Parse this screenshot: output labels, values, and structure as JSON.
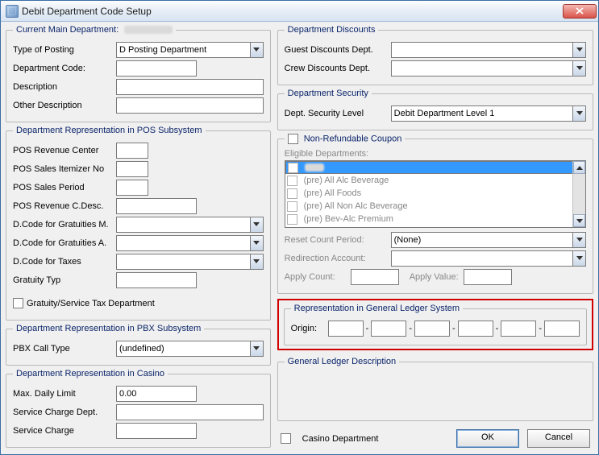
{
  "window": {
    "title": "Debit Department Code Setup"
  },
  "left": {
    "main_dept": {
      "legend": "Current Main Department:",
      "type_of_posting_label": "Type of Posting",
      "type_of_posting_value": "D Posting Department",
      "dept_code_label": "Department Code:",
      "dept_code_value": "",
      "description_label": "Description",
      "description_value": "",
      "other_desc_label": "Other Description",
      "other_desc_value": ""
    },
    "pos": {
      "legend": "Department Representation in POS Subsystem",
      "rev_center_label": "POS Revenue Center",
      "rev_center_value": "",
      "itemizer_label": "POS Sales Itemizer No",
      "itemizer_value": "",
      "sales_period_label": "POS Sales Period",
      "sales_period_value": "",
      "rev_cdesc_label": "POS Revenue C.Desc.",
      "rev_cdesc_value": "",
      "grat_m_label": "D.Code for Gratuities M.",
      "grat_m_value": "",
      "grat_a_label": "D.Code for Gratuities A.",
      "grat_a_value": "",
      "taxes_label": "D.Code for Taxes",
      "taxes_value": "",
      "grat_typ_label": "Gratuity Typ",
      "grat_typ_value": "",
      "gst_check_label": "Gratuity/Service Tax Department"
    },
    "pbx": {
      "legend": "Department Representation in PBX Subsystem",
      "call_type_label": "PBX Call Type",
      "call_type_value": "(undefined)"
    },
    "casino": {
      "legend": "Department Representation in Casino",
      "max_daily_label": "Max. Daily Limit",
      "max_daily_value": "0.00",
      "svc_dept_label": "Service Charge Dept.",
      "svc_dept_value": "",
      "svc_charge_label": "Service Charge",
      "svc_charge_value": ""
    }
  },
  "right": {
    "discounts": {
      "legend": "Department Discounts",
      "guest_label": "Guest Discounts Dept.",
      "guest_value": "",
      "crew_label": "Crew Discounts Dept.",
      "crew_value": ""
    },
    "security": {
      "legend": "Department Security",
      "level_label": "Dept. Security Level",
      "level_value": "Debit Department Level 1"
    },
    "coupon": {
      "nonref_label": "Non-Refundable Coupon",
      "eligible_label": "Eligible Departments:",
      "items": [
        {
          "label": "",
          "selected": true
        },
        {
          "label": "(pre) All Alc Beverage",
          "selected": false
        },
        {
          "label": "(pre) All Foods",
          "selected": false
        },
        {
          "label": "(pre) All Non Alc Beverage",
          "selected": false
        },
        {
          "label": "(pre) Bev-Alc Premium",
          "selected": false
        }
      ],
      "reset_label": "Reset Count Period:",
      "reset_value": "(None)",
      "redirect_label": "Redirection Account:",
      "redirect_value": "",
      "apply_count_label": "Apply Count:",
      "apply_count_value": "",
      "apply_value_label": "Apply Value:",
      "apply_value_value": ""
    },
    "gl": {
      "legend": "Representation in General Ledger System",
      "origin_label": "Origin:",
      "v1": "",
      "v2": "",
      "v3": "",
      "v4": "",
      "v5": "",
      "v6": ""
    },
    "gl_desc": {
      "legend": "General Ledger Description"
    },
    "footer": {
      "casino_dept_label": "Casino Department",
      "ok_label": "OK",
      "cancel_label": "Cancel"
    }
  }
}
